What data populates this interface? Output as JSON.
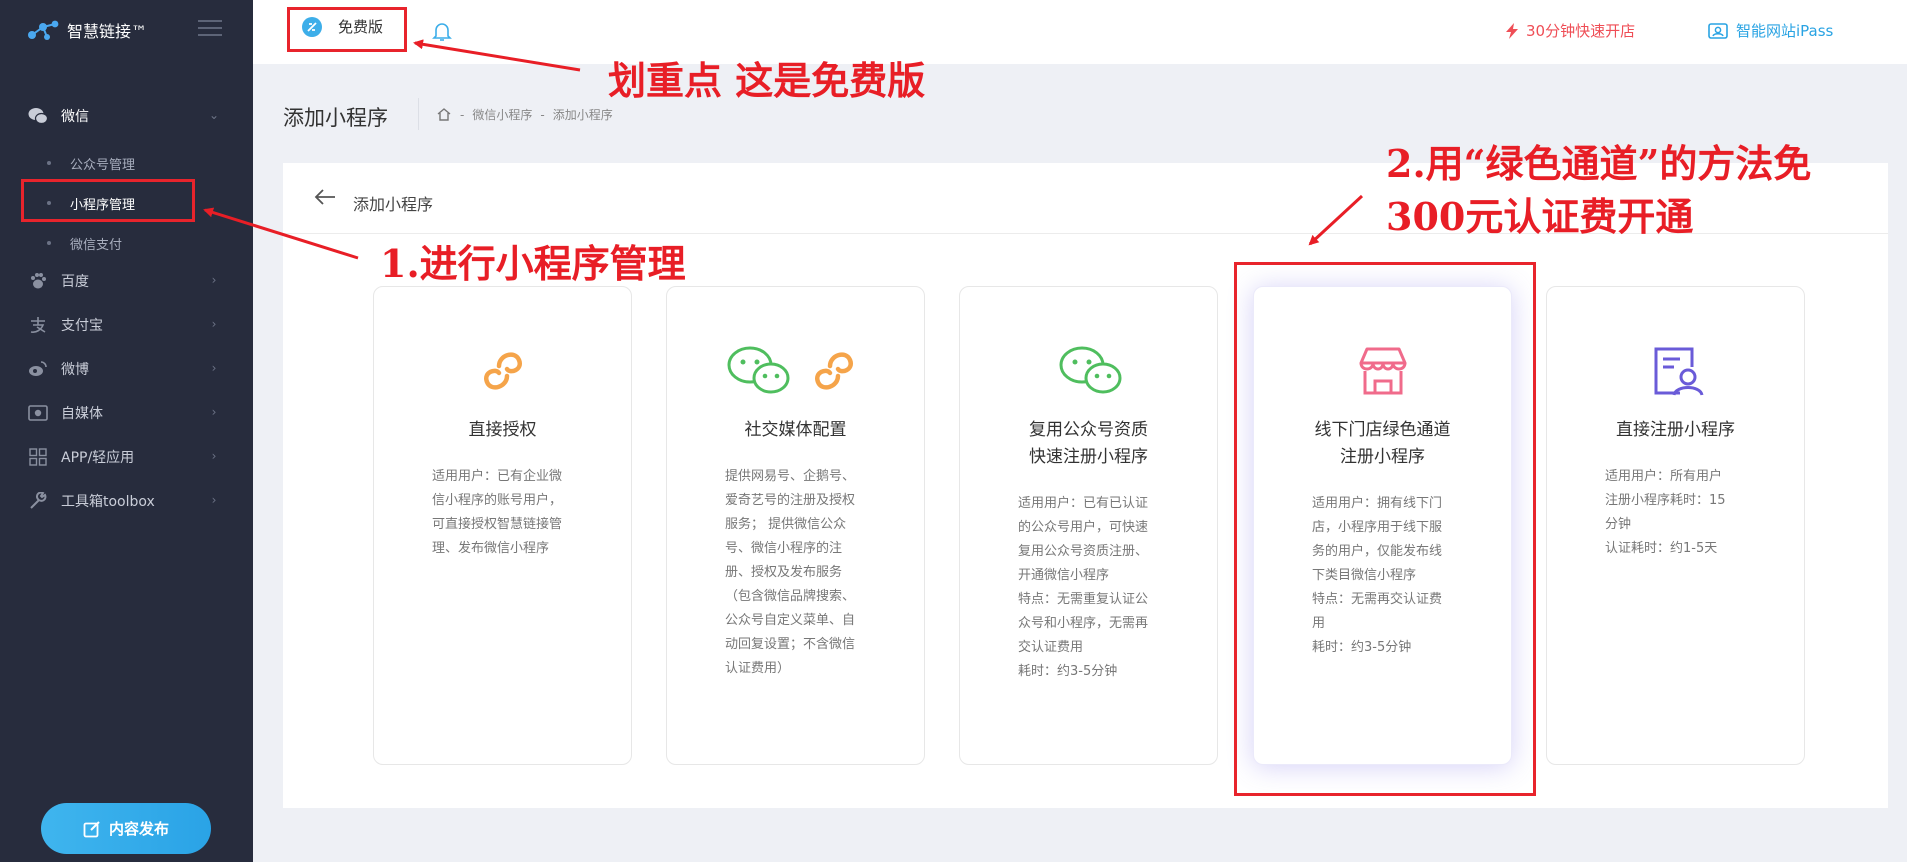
{
  "app": {
    "name": "智慧链接™"
  },
  "sidebar": {
    "menu": [
      {
        "label": "微信",
        "icon": "wechat-icon",
        "expanded": true,
        "children": [
          {
            "label": "公众号管理"
          },
          {
            "label": "小程序管理",
            "active": true
          },
          {
            "label": "微信支付"
          }
        ]
      },
      {
        "label": "百度",
        "icon": "paw-icon"
      },
      {
        "label": "支付宝",
        "icon": "alipay-icon"
      },
      {
        "label": "微博",
        "icon": "weibo-icon"
      },
      {
        "label": "自媒体",
        "icon": "media-icon"
      },
      {
        "label": "APP/轻应用",
        "icon": "app-grid-icon"
      },
      {
        "label": "工具箱toolbox",
        "icon": "wrench-icon"
      }
    ],
    "publish_label": "内容发布"
  },
  "topbar": {
    "edition_label": "免费版",
    "fast_open_label": "30分钟快速开店",
    "ipass_label": "智能网站iPass",
    "accent_red": "#ef4e56",
    "accent_blue": "#29a3e3"
  },
  "page": {
    "title": "添加小程序",
    "breadcrumb": [
      "微信小程序",
      "添加小程序"
    ],
    "breadcrumb_sep": "-"
  },
  "card": {
    "title": "添加小程序",
    "options": [
      {
        "title": "直接授权",
        "icon": "link-orange-icon",
        "desc": [
          "适用用户：已有企业微",
          "信小程序的账号用户，",
          "可直接授权智慧链接管",
          "理、发布微信小程序"
        ]
      },
      {
        "title": "社交媒体配置",
        "icon": "wechat-link-icon",
        "desc": [
          "提供网易号、企鹅号、",
          "爱奇艺号的注册及授权",
          "服务； 提供微信公众",
          "号、微信小程序的注",
          "册、授权及发布服务",
          "（包含微信品牌搜索、",
          "公众号自定义菜单、自",
          "动回复设置；不含微信",
          "认证费用）"
        ]
      },
      {
        "title": "复用公众号资质\n快速注册小程序",
        "title_lines": [
          "复用公众号资质",
          "快速注册小程序"
        ],
        "icon": "wechat-green-icon",
        "desc": [
          "适用用户：已有已认证",
          "的公众号用户，可快速",
          "复用公众号资质注册、",
          "开通微信小程序",
          "特点：无需重复认证公",
          "众号和小程序，无需再",
          "交认证费用",
          "耗时：约3-5分钟"
        ]
      },
      {
        "title": "线下门店绿色通道\n注册小程序",
        "title_lines": [
          "线下门店绿色通道",
          "注册小程序"
        ],
        "icon": "store-pink-icon",
        "highlighted": true,
        "desc": [
          "适用用户：拥有线下门",
          "店，小程序用于线下服",
          "务的用户，仅能发布线",
          "下类目微信小程序",
          "特点：无需再交认证费",
          "用",
          "耗时：约3-5分钟"
        ]
      },
      {
        "title": "直接注册小程序",
        "icon": "id-card-purple-icon",
        "desc": [
          "适用用户：所有用户",
          "注册小程序耗时：15",
          "分钟",
          "认证耗时：约1-5天"
        ]
      }
    ]
  },
  "annotations": {
    "free_note": "划重点 这是免费版",
    "step1": "1.进行小程序管理",
    "step2_line1": "2.用“绿色通道”的方法免",
    "step2_line2": "300元认证费开通",
    "color": "#e81e26"
  }
}
